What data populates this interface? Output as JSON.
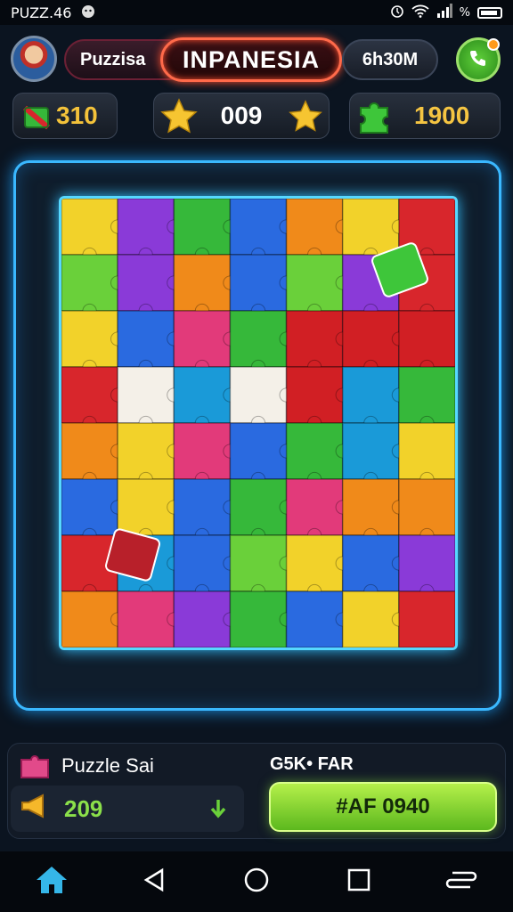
{
  "status_bar": {
    "time": "PUZZ.46",
    "right_text": "% ",
    "icons": [
      "android-icon",
      "alarm-icon",
      "wifi-icon",
      "signal-icon",
      "battery-icon"
    ]
  },
  "header": {
    "player_name": "Puzzisa",
    "title": "INPANESIA",
    "timer": "6h30M",
    "help_icon": "phone-help-icon"
  },
  "stats": {
    "puzzles": "310",
    "stars": "009",
    "pieces": "1900"
  },
  "board": {
    "grid_rows": 8,
    "grid_cols": 7,
    "palette": [
      "#d8262c",
      "#36b83a",
      "#2a6ae0",
      "#f08a1a",
      "#f2d22a",
      "#8a3ad8",
      "#e23a7a",
      "#6ad03a",
      "#1a9ad8"
    ],
    "image_colors": {
      "red": "#d11f24",
      "white": "#f4f0e8",
      "green": "#3ec63a"
    }
  },
  "bottom": {
    "puzzle_label": "Puzzle Sai",
    "right_label": "G5K• FAR",
    "coins": "209",
    "play_button": "#AF 0940"
  },
  "colors": {
    "accent": "#3ab8ff",
    "play_green": "#7ad82e",
    "title_border": "#ff6a4a"
  }
}
